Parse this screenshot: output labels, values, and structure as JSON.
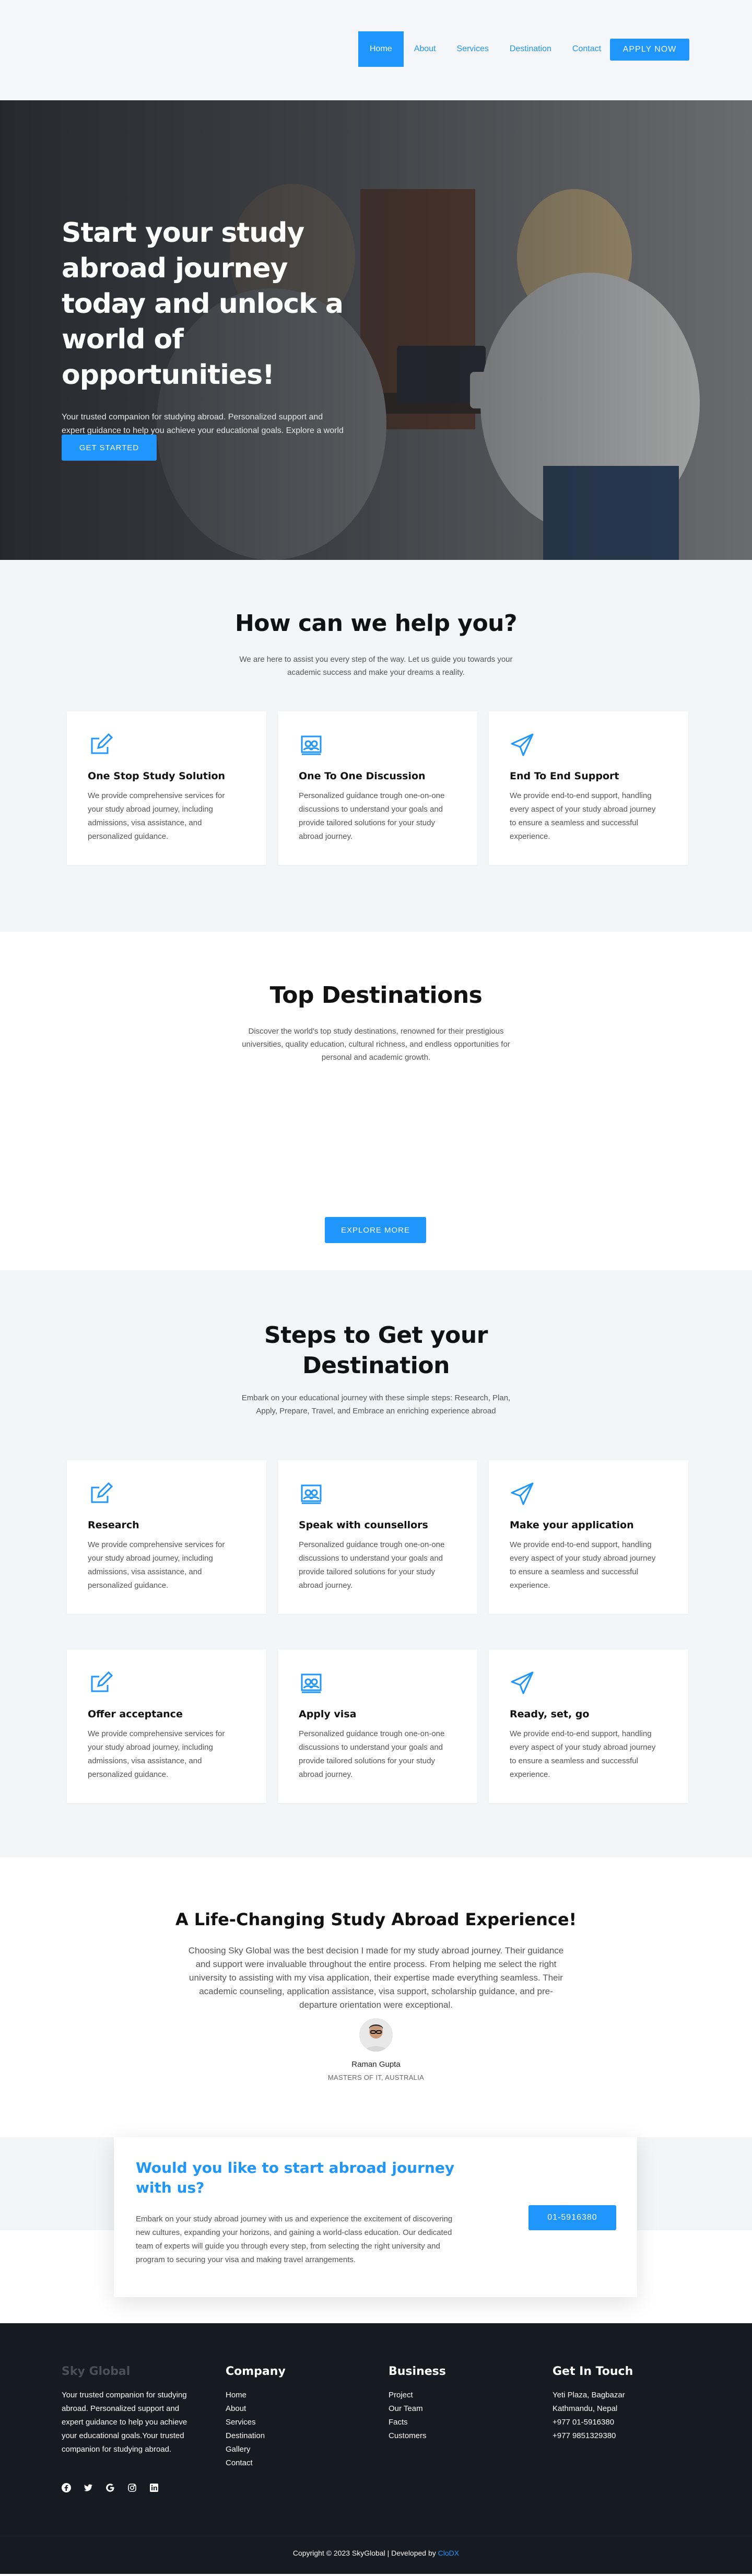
{
  "nav": {
    "links": [
      "Home",
      "About",
      "Services",
      "Destination",
      "Contact"
    ],
    "apply": "APPLY NOW"
  },
  "hero": {
    "title": "Start your study abroad journey today and unlock a world of opportunities!",
    "text": "Your trusted companion for studying abroad. Personalized support and expert guidance to help you achieve your educational goals. Explore a world of opportunities with us.",
    "button": "GET STARTED"
  },
  "help": {
    "title": "How can we help you?",
    "subtitle": "We are here to assist you every step of the way. Let us guide you towards your academic success and make your dreams a reality.",
    "cards": [
      {
        "icon": "edit-icon",
        "title": "One Stop Study Solution",
        "text": "We provide comprehensive services for your study abroad journey, including admissions, visa assistance, and personalized guidance."
      },
      {
        "icon": "discussion-icon",
        "title": "One To One Discussion",
        "text": "Personalized guidance trough one-on-one discussions to understand your goals and provide tailored solutions for your study abroad journey."
      },
      {
        "icon": "paper-plane-icon",
        "title": "End To End Support",
        "text": "We provide end-to-end support, handling every aspect of your study abroad journey to ensure a seamless and successful experience."
      }
    ]
  },
  "destinations": {
    "title": "Top Destinations",
    "subtitle": "Discover the world's top study destinations, renowned for their prestigious universities, quality education, cultural richness, and endless opportunities for personal and academic growth.",
    "button": "EXPLORE MORE"
  },
  "steps": {
    "title": "Steps to Get your Destination",
    "subtitle": "Embark on your educational journey with these simple steps: Research, Plan, Apply, Prepare, Travel, and Embrace an enriching experience abroad",
    "cards": [
      {
        "icon": "edit-icon",
        "title": "Research",
        "text": "We provide comprehensive services for your study abroad journey, including admissions, visa assistance, and personalized guidance."
      },
      {
        "icon": "discussion-icon",
        "title": "Speak with counsellors",
        "text": "Personalized guidance trough one-on-one discussions to understand your goals and provide tailored solutions for your study abroad journey."
      },
      {
        "icon": "paper-plane-icon",
        "title": "Make your application",
        "text": "We provide end-to-end support, handling every aspect of your study abroad journey to ensure a seamless and successful experience."
      },
      {
        "icon": "edit-icon",
        "title": "Offer acceptance",
        "text": "We provide comprehensive services for your study abroad journey, including admissions, visa assistance, and personalized guidance."
      },
      {
        "icon": "discussion-icon",
        "title": "Apply visa",
        "text": "Personalized guidance trough one-on-one discussions to understand your goals and provide tailored solutions for your study abroad journey."
      },
      {
        "icon": "paper-plane-icon",
        "title": "Ready, set, go",
        "text": "We provide end-to-end support, handling every aspect of your study abroad journey to ensure a seamless and successful experience."
      }
    ]
  },
  "testimonial": {
    "title": "A Life-Changing Study Abroad Experience!",
    "quote": "Choosing Sky Global was the best decision I made for my study abroad journey. Their guidance and support were invaluable throughout the entire process. From helping me select the right university to assisting with my visa application, their expertise made everything seamless. Their academic counseling, application assistance, visa support, scholarship guidance, and pre-departure orientation were exceptional.",
    "name": "Raman Gupta",
    "role": "MASTERS OF IT, AUSTRALIA"
  },
  "cta": {
    "title": "Would you like to start abroad journey with us?",
    "text": "Embark on your study abroad journey with us and experience the excitement of discovering new cultures, expanding your horizons, and gaining a world-class education. Our dedicated team of experts will guide you through every step, from selecting the right university and program to securing your visa and making travel arrangements.",
    "phone": "01-5916380"
  },
  "footer": {
    "brand": "Sky Global",
    "about": "Your trusted companion for studying abroad. Personalized support and expert guidance to help you achieve your educational goals.Your trusted companion for studying abroad.",
    "company_title": "Company",
    "company_links": [
      "Home",
      "About",
      "Services",
      "Destination",
      "Gallery",
      "Contact"
    ],
    "business_title": "Business",
    "business_links": [
      "Project",
      "Our Team",
      "Facts",
      "Customers"
    ],
    "contact_title": "Get In Touch",
    "contact_lines": [
      "Yeti Plaza, Bagbazar",
      "Kathmandu, Nepal",
      "+977 01-5916380",
      "+977 9851329380"
    ],
    "copyright": "Copyright © 2023 SkyGlobal | Developed by",
    "developer": "CloDX"
  },
  "colors": {
    "accent": "#1e96fc",
    "footer_bg": "#161a21",
    "section_bg": "#f3f5f7"
  }
}
